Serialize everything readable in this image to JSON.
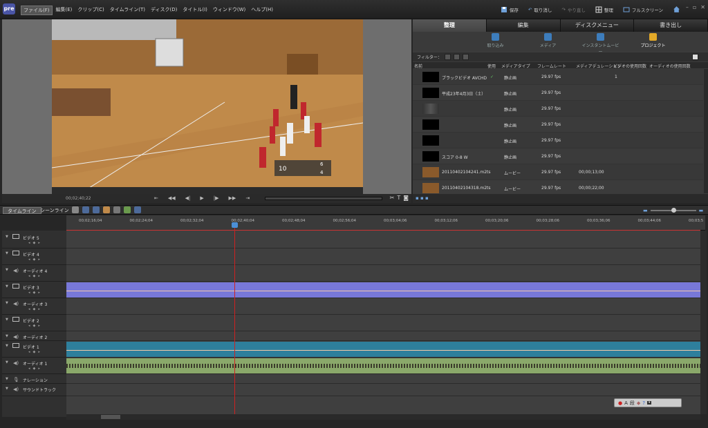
{
  "app": {
    "logo": "pre",
    "menu": [
      "ファイル(F)",
      "編集(E)",
      "クリップ(C)",
      "タイムライン(T)",
      "ディスク(D)",
      "タイトル(I)",
      "ウィンドウ(W)",
      "ヘルプ(H)"
    ],
    "toolbar": {
      "save": "保存",
      "undo": "取り消し",
      "redo": "やり直し",
      "organize": "整理",
      "fullscreen": "フルスクリーン"
    }
  },
  "monitor": {
    "timecode": "00;02;40;22",
    "scoreboard": {
      "left": "10",
      "right_top": "6",
      "right_bottom": "4"
    }
  },
  "right_panel": {
    "tabs": [
      "整理",
      "編集",
      "ディスクメニュー",
      "書き出し"
    ],
    "active_tab": 0,
    "tools": [
      "取り込み",
      "メディア",
      "インスタントムービー",
      "プロジェクト"
    ],
    "active_tool": 3,
    "filter_label": "フィルター：",
    "columns": [
      "名前",
      "使用",
      "メディアタイプ",
      "フレームレート",
      "メディアデュレーション",
      "ビデオの使用回数",
      "オーディオの使用回数"
    ],
    "rows": [
      {
        "name": "ブラックビデオ AVCHD",
        "used": "✓",
        "type": "静止画",
        "fps": "29.97 fps",
        "duration": "",
        "video_uses": "1",
        "thumb": "black"
      },
      {
        "name": "平成23年4月3日（土）",
        "used": "",
        "type": "静止画",
        "fps": "29.97 fps",
        "duration": "",
        "video_uses": "",
        "thumb": "black"
      },
      {
        "name": "",
        "used": "",
        "type": "静止画",
        "fps": "29.97 fps",
        "duration": "",
        "video_uses": "",
        "thumb": "blur"
      },
      {
        "name": "",
        "used": "",
        "type": "静止画",
        "fps": "29.97 fps",
        "duration": "",
        "video_uses": "",
        "thumb": "black"
      },
      {
        "name": "",
        "used": "",
        "type": "静止画",
        "fps": "29.97 fps",
        "duration": "",
        "video_uses": "",
        "thumb": "black"
      },
      {
        "name": "スコア  0-8 W",
        "used": "",
        "type": "静止画",
        "fps": "29.97 fps",
        "duration": "",
        "video_uses": "",
        "thumb": "black"
      },
      {
        "name": "20110402104241.m2ts",
        "used": "",
        "type": "ムービー",
        "fps": "29.97 fps",
        "duration": "00;00;13;00",
        "video_uses": "",
        "thumb": "video"
      },
      {
        "name": "20110402104318.m2ts",
        "used": "",
        "type": "ムービー",
        "fps": "29.97 fps",
        "duration": "00;00;22;00",
        "video_uses": "",
        "thumb": "video"
      }
    ]
  },
  "timeline": {
    "tabs": [
      "タイムライン",
      "シーンライン"
    ],
    "ruler": [
      "00;02;16;04",
      "00;02;24;04",
      "00;02;32;04",
      "00;02;40;04",
      "00;02;48;04",
      "00;02;56;04",
      "00;03;04;06",
      "00;03;12;06",
      "00;03;20;06",
      "00;03;28;06",
      "00;03;36;06",
      "00;03;44;06",
      "00;03;5"
    ],
    "tracks": [
      {
        "name": "ビデオ 5",
        "kind": "video"
      },
      {
        "name": "ビデオ 4",
        "kind": "video"
      },
      {
        "name": "オーディオ 4",
        "kind": "audio"
      },
      {
        "name": "ビデオ 3",
        "kind": "video"
      },
      {
        "name": "オーディオ 3",
        "kind": "audio"
      },
      {
        "name": "ビデオ 2",
        "kind": "video"
      },
      {
        "name": "オーディオ 2",
        "kind": "audio"
      },
      {
        "name": "ビデオ 1",
        "kind": "video"
      },
      {
        "name": "オーディオ 1",
        "kind": "audio"
      },
      {
        "name": "ナレーション",
        "kind": "narration"
      },
      {
        "name": "サウンドトラック",
        "kind": "soundtrack"
      }
    ],
    "mini_panel_label": "A"
  }
}
